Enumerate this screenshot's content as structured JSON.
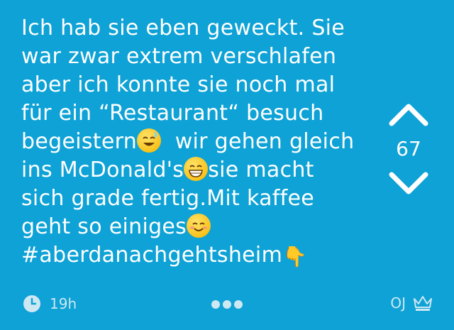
{
  "post": {
    "line1": "Ich hab sie eben geweckt. Sie",
    "line2": "war zwar extrem verschlafen",
    "line3": "aber ich konnte sie noch mal",
    "line4": "für ein “Restaurant“ besuch",
    "line5a": "begeistern",
    "line5b": "  wir gehen gleich",
    "line6a": "ins McDonald's",
    "line6b": "sie macht",
    "line7": "sich grade fertig.Mit kaffee",
    "line8": "geht so einiges",
    "line9": "#aberdanachgehtsheim"
  },
  "vote": {
    "count": "67"
  },
  "footer": {
    "time": "19h",
    "author": "OJ"
  },
  "colors": {
    "background": "#0ea2d6",
    "text": "#ffffff",
    "muted": "#cde8f2"
  }
}
